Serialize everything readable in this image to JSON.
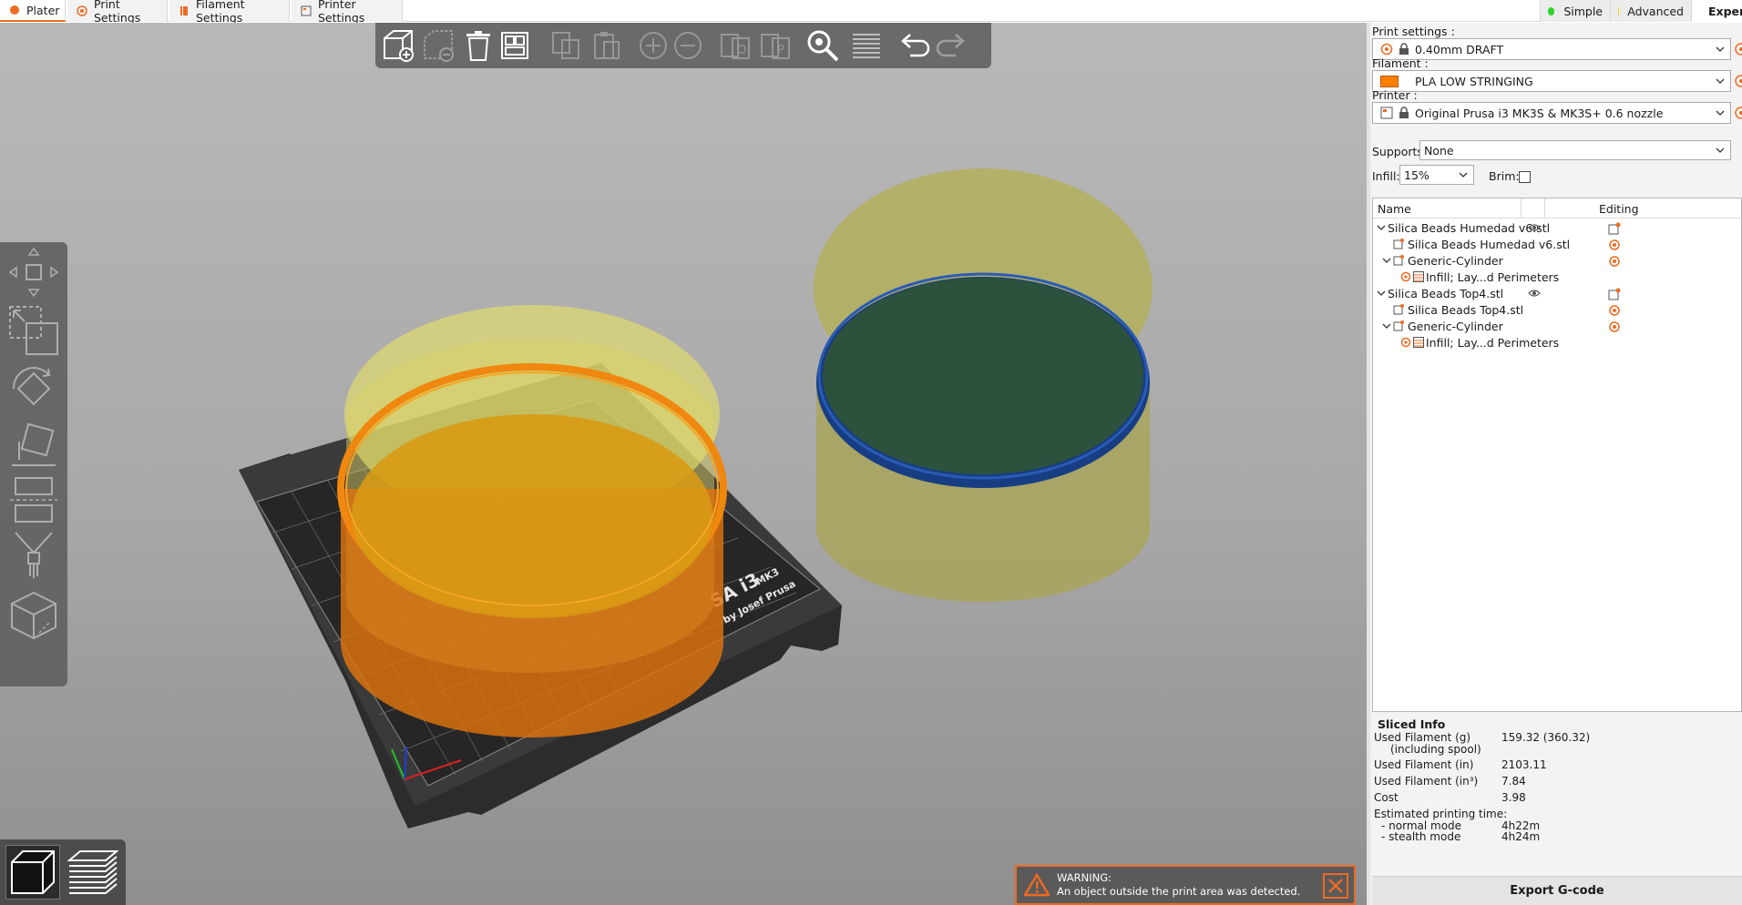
{
  "tabs": [
    {
      "label": "Plater",
      "icon": "plater-icon",
      "active": true
    },
    {
      "label": "Print Settings",
      "icon": "print-settings-icon",
      "active": false
    },
    {
      "label": "Filament Settings",
      "icon": "filament-settings-icon",
      "active": false
    },
    {
      "label": "Printer Settings",
      "icon": "printer-settings-icon",
      "active": false
    }
  ],
  "modes": [
    {
      "label": "Simple",
      "color": "#2bd22b",
      "active": false
    },
    {
      "label": "Advanced",
      "color": "#f5d20a",
      "active": false
    },
    {
      "label": "Expert",
      "color": "#e01414",
      "active": true
    }
  ],
  "accent_color": "#ed6b21",
  "canvas": {
    "bed_label_1": "SA i3",
    "bed_label_2": "MK3",
    "bed_label_3": "by Josef Prusa",
    "warning_title": "WARNING:",
    "warning_message": "An object outside the print area was detected."
  },
  "sidebar": {
    "print_settings_label": "Print settings :",
    "print_settings_value": "0.40mm DRAFT",
    "filament_label": "Filament :",
    "filament_value": "PLA LOW STRINGING",
    "filament_color": "#ff8000",
    "printer_label": "Printer :",
    "printer_value": "Original Prusa i3 MK3S & MK3S+ 0.6 nozzle",
    "supports_label": "Supports:",
    "supports_value": "None",
    "infill_label": "Infill:",
    "infill_value": "15%",
    "brim_label": "Brim:",
    "brim_checked": false
  },
  "object_list": {
    "col_name": "Name",
    "col_editing": "Editing",
    "rows": [
      {
        "name": "Silica Beads Humedad v6.stl",
        "level": 0
      },
      {
        "name": "Silica Beads Humedad v6.stl",
        "level": 1
      },
      {
        "name": "Generic-Cylinder",
        "level": 1
      },
      {
        "name": "Infill; Lay...d Perimeters",
        "level": 2
      },
      {
        "name": "Silica Beads Top4.stl",
        "level": 0
      },
      {
        "name": "Silica Beads Top4.stl",
        "level": 1
      },
      {
        "name": "Generic-Cylinder",
        "level": 1
      },
      {
        "name": "Infill; Lay...d Perimeters",
        "level": 2
      }
    ]
  },
  "sliced_info": {
    "title": "Sliced Info",
    "used_filament_g_label": "Used Filament (g)",
    "including_spool_label": "(including spool)",
    "used_filament_g_value": "159.32 (360.32)",
    "used_filament_in_label": "Used Filament (in)",
    "used_filament_in_value": "2103.11",
    "used_filament_in3_label": "Used Filament (in³)",
    "used_filament_in3_value": "7.84",
    "cost_label": "Cost",
    "cost_value": "3.98",
    "est_time_label": "Estimated printing time:",
    "normal_mode_label": "- normal mode",
    "normal_mode_value": "4h22m",
    "stealth_mode_label": "- stealth mode",
    "stealth_mode_value": "4h24m"
  },
  "export_label": "Export G-code"
}
